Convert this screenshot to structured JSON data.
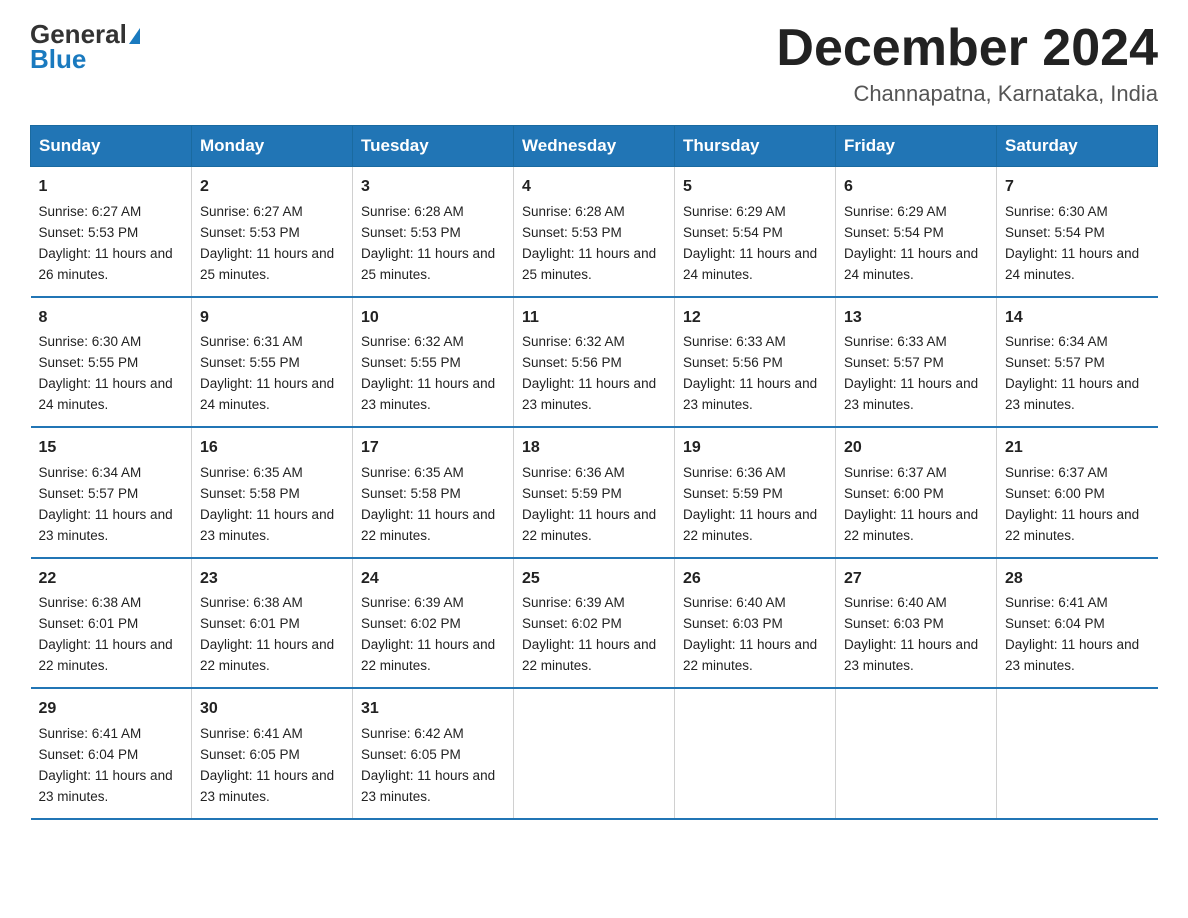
{
  "logo": {
    "line1": "General",
    "triangle": "▶",
    "line2": "Blue"
  },
  "title": "December 2024",
  "location": "Channapatna, Karnataka, India",
  "days_of_week": [
    "Sunday",
    "Monday",
    "Tuesday",
    "Wednesday",
    "Thursday",
    "Friday",
    "Saturday"
  ],
  "weeks": [
    [
      {
        "day": 1,
        "sunrise": "6:27 AM",
        "sunset": "5:53 PM",
        "daylight": "11 hours and 26 minutes."
      },
      {
        "day": 2,
        "sunrise": "6:27 AM",
        "sunset": "5:53 PM",
        "daylight": "11 hours and 25 minutes."
      },
      {
        "day": 3,
        "sunrise": "6:28 AM",
        "sunset": "5:53 PM",
        "daylight": "11 hours and 25 minutes."
      },
      {
        "day": 4,
        "sunrise": "6:28 AM",
        "sunset": "5:53 PM",
        "daylight": "11 hours and 25 minutes."
      },
      {
        "day": 5,
        "sunrise": "6:29 AM",
        "sunset": "5:54 PM",
        "daylight": "11 hours and 24 minutes."
      },
      {
        "day": 6,
        "sunrise": "6:29 AM",
        "sunset": "5:54 PM",
        "daylight": "11 hours and 24 minutes."
      },
      {
        "day": 7,
        "sunrise": "6:30 AM",
        "sunset": "5:54 PM",
        "daylight": "11 hours and 24 minutes."
      }
    ],
    [
      {
        "day": 8,
        "sunrise": "6:30 AM",
        "sunset": "5:55 PM",
        "daylight": "11 hours and 24 minutes."
      },
      {
        "day": 9,
        "sunrise": "6:31 AM",
        "sunset": "5:55 PM",
        "daylight": "11 hours and 24 minutes."
      },
      {
        "day": 10,
        "sunrise": "6:32 AM",
        "sunset": "5:55 PM",
        "daylight": "11 hours and 23 minutes."
      },
      {
        "day": 11,
        "sunrise": "6:32 AM",
        "sunset": "5:56 PM",
        "daylight": "11 hours and 23 minutes."
      },
      {
        "day": 12,
        "sunrise": "6:33 AM",
        "sunset": "5:56 PM",
        "daylight": "11 hours and 23 minutes."
      },
      {
        "day": 13,
        "sunrise": "6:33 AM",
        "sunset": "5:57 PM",
        "daylight": "11 hours and 23 minutes."
      },
      {
        "day": 14,
        "sunrise": "6:34 AM",
        "sunset": "5:57 PM",
        "daylight": "11 hours and 23 minutes."
      }
    ],
    [
      {
        "day": 15,
        "sunrise": "6:34 AM",
        "sunset": "5:57 PM",
        "daylight": "11 hours and 23 minutes."
      },
      {
        "day": 16,
        "sunrise": "6:35 AM",
        "sunset": "5:58 PM",
        "daylight": "11 hours and 23 minutes."
      },
      {
        "day": 17,
        "sunrise": "6:35 AM",
        "sunset": "5:58 PM",
        "daylight": "11 hours and 22 minutes."
      },
      {
        "day": 18,
        "sunrise": "6:36 AM",
        "sunset": "5:59 PM",
        "daylight": "11 hours and 22 minutes."
      },
      {
        "day": 19,
        "sunrise": "6:36 AM",
        "sunset": "5:59 PM",
        "daylight": "11 hours and 22 minutes."
      },
      {
        "day": 20,
        "sunrise": "6:37 AM",
        "sunset": "6:00 PM",
        "daylight": "11 hours and 22 minutes."
      },
      {
        "day": 21,
        "sunrise": "6:37 AM",
        "sunset": "6:00 PM",
        "daylight": "11 hours and 22 minutes."
      }
    ],
    [
      {
        "day": 22,
        "sunrise": "6:38 AM",
        "sunset": "6:01 PM",
        "daylight": "11 hours and 22 minutes."
      },
      {
        "day": 23,
        "sunrise": "6:38 AM",
        "sunset": "6:01 PM",
        "daylight": "11 hours and 22 minutes."
      },
      {
        "day": 24,
        "sunrise": "6:39 AM",
        "sunset": "6:02 PM",
        "daylight": "11 hours and 22 minutes."
      },
      {
        "day": 25,
        "sunrise": "6:39 AM",
        "sunset": "6:02 PM",
        "daylight": "11 hours and 22 minutes."
      },
      {
        "day": 26,
        "sunrise": "6:40 AM",
        "sunset": "6:03 PM",
        "daylight": "11 hours and 22 minutes."
      },
      {
        "day": 27,
        "sunrise": "6:40 AM",
        "sunset": "6:03 PM",
        "daylight": "11 hours and 23 minutes."
      },
      {
        "day": 28,
        "sunrise": "6:41 AM",
        "sunset": "6:04 PM",
        "daylight": "11 hours and 23 minutes."
      }
    ],
    [
      {
        "day": 29,
        "sunrise": "6:41 AM",
        "sunset": "6:04 PM",
        "daylight": "11 hours and 23 minutes."
      },
      {
        "day": 30,
        "sunrise": "6:41 AM",
        "sunset": "6:05 PM",
        "daylight": "11 hours and 23 minutes."
      },
      {
        "day": 31,
        "sunrise": "6:42 AM",
        "sunset": "6:05 PM",
        "daylight": "11 hours and 23 minutes."
      },
      null,
      null,
      null,
      null
    ]
  ]
}
